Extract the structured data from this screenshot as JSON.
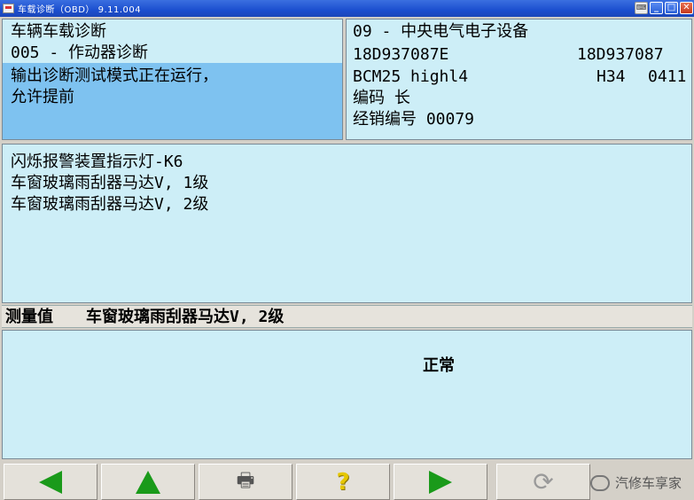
{
  "window": {
    "title": "车载诊断（OBD） 9.11.004"
  },
  "top_left": {
    "line1": "车辆车载诊断",
    "line2": "005 - 作动器诊断",
    "line3": "输出诊断测试模式正在运行，",
    "line4": "允许提前"
  },
  "top_right": {
    "module": "09 - 中央电气电子设备",
    "part_number": "18D937087E",
    "part_number2": "18D937087",
    "component": "BCM25 highl4",
    "version": "H34",
    "version2": "0411",
    "coding": "编码 长",
    "dealer": "经销编号 00079"
  },
  "actuators": {
    "items": [
      "闪烁报警装置指示灯-K6",
      "车窗玻璃雨刮器马达V, 1级",
      "车窗玻璃雨刮器马达V, 2级"
    ]
  },
  "measurement": {
    "label": "测量值",
    "name": "车窗玻璃雨刮器马达V, 2级",
    "result": "正常"
  },
  "toolbar": {
    "back": "back-arrow-icon",
    "up": "up-arrow-icon",
    "print": "printer-icon",
    "help": "help-icon",
    "forward": "forward-arrow-icon",
    "refresh": "refresh-icon"
  },
  "watermark": {
    "text": "汽修车享家"
  },
  "colors": {
    "panel": "#cdeef7",
    "selection": "#7ec2f0",
    "titlebar": "#1c4fcf",
    "arrow": "#1a9a1a"
  }
}
